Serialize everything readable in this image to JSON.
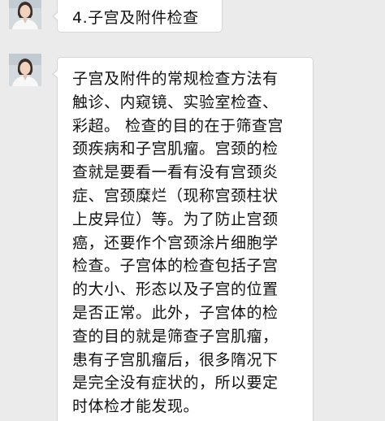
{
  "messages": [
    {
      "sender": "avatar",
      "text": "4.子宫及附件检查"
    },
    {
      "sender": "avatar",
      "lines": [
        "子宫及附件的常规检查方法有",
        "触诊、内窥镜、实验室检查、",
        "彩超。 检查的目的在于筛查宫",
        "颈疾病和子宫肌瘤。宫颈的检",
        "查就是要看一看有没有宫颈炎",
        "症、宫颈糜烂（现称宫颈柱状",
        "上皮异位）等。为了防止宫颈",
        "癌，还要作个宫颈涂片细胞学",
        "检查。子宫体的检查包括子宫",
        "的大小、形态以及子宫的位置",
        "是否正常。此外，子宫体的检",
        "查的目的就是筛查子宫肌瘤，",
        "患有子宫肌瘤后，很多隋况下",
        "是完全没有症状的，所以要定",
        "时体检才能发现。"
      ]
    }
  ],
  "colors": {
    "background": "#ebebeb",
    "bubble": "#ffffff",
    "bubble_border": "#d6d6d6",
    "text": "#111111"
  }
}
